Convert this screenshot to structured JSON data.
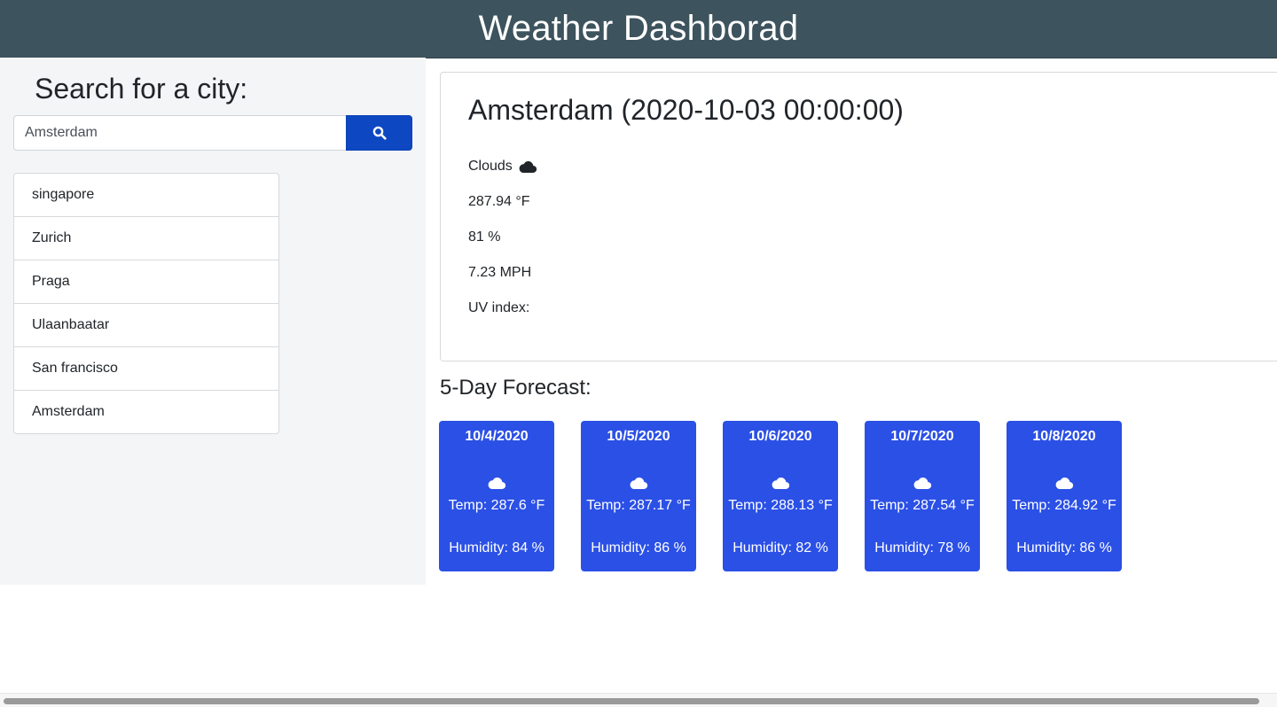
{
  "header": {
    "title": "Weather Dashborad"
  },
  "sidebar": {
    "search_title": "Search for a city:",
    "search_value": "Amsterdam",
    "search_icon": "search-icon",
    "history": [
      "singapore",
      "Zurich",
      "Praga",
      "Ulaanbaatar",
      "San francisco",
      "Amsterdam"
    ]
  },
  "current": {
    "title": "Amsterdam (2020-10-03 00:00:00)",
    "condition": "Clouds",
    "condition_icon": "cloud-icon",
    "temperature": "287.94 °F",
    "humidity": "81 %",
    "wind": "7.23 MPH",
    "uv_label": "UV index:"
  },
  "forecast": {
    "title": "5-Day Forecast:",
    "days": [
      {
        "date": "10/4/2020",
        "temp": "Temp: 287.6 °F",
        "humidity": "Humidity: 84 %",
        "icon": "cloud-icon"
      },
      {
        "date": "10/5/2020",
        "temp": "Temp: 287.17 °F",
        "humidity": "Humidity: 86 %",
        "icon": "cloud-icon"
      },
      {
        "date": "10/6/2020",
        "temp": "Temp: 288.13 °F",
        "humidity": "Humidity: 82 %",
        "icon": "cloud-icon"
      },
      {
        "date": "10/7/2020",
        "temp": "Temp: 287.54 °F",
        "humidity": "Humidity: 78 %",
        "icon": "cloud-icon"
      },
      {
        "date": "10/8/2020",
        "temp": "Temp: 284.92 °F",
        "humidity": "Humidity: 86 %",
        "icon": "cloud-icon"
      }
    ]
  },
  "colors": {
    "header_bg": "#3d535d",
    "sidebar_bg": "#f4f5f7",
    "search_button": "#0d47c2",
    "forecast_card": "#2b50e6"
  }
}
